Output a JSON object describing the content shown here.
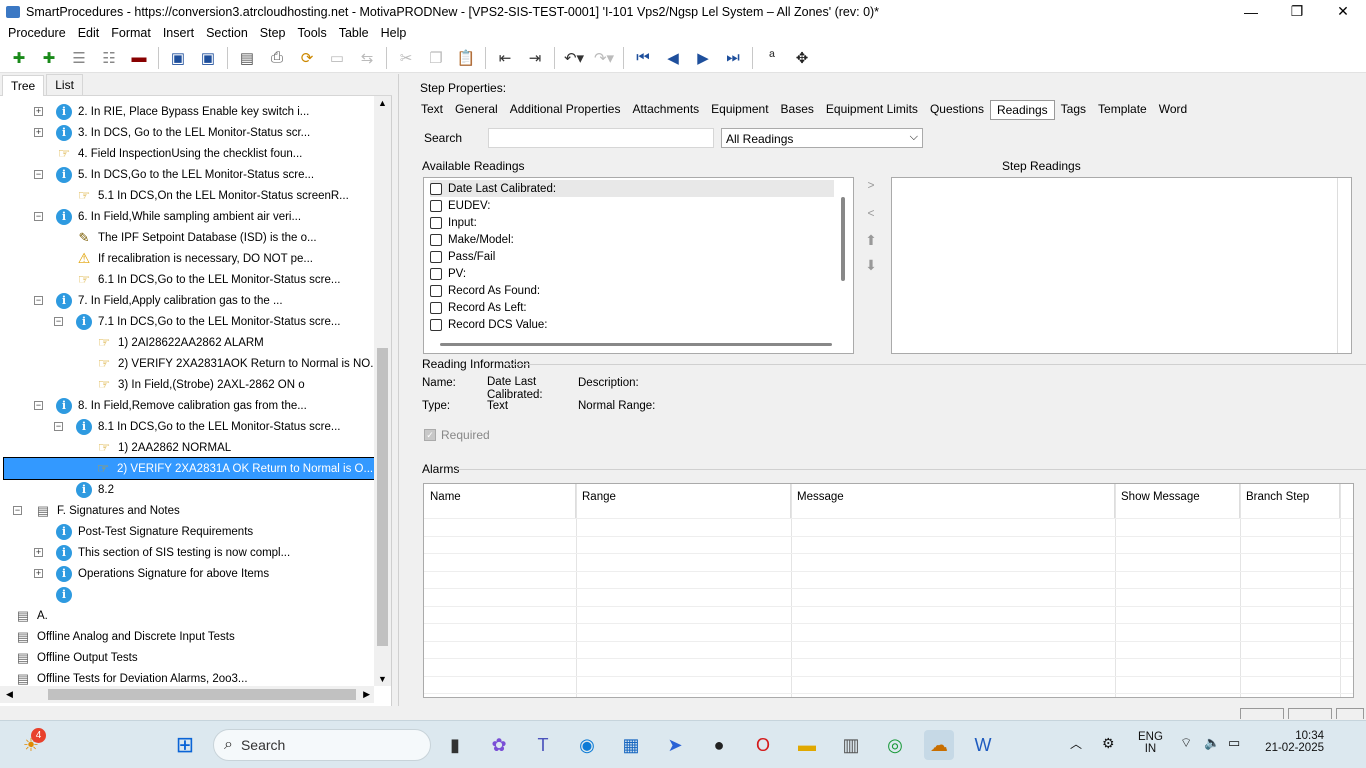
{
  "window": {
    "title": "SmartProcedures - https://conversion3.atrcloudhosting.net - MotivaPRODNew - [VPS2-SIS-TEST-0001] 'I-101 Vps2/Ngsp Lel System – All Zones' (rev: 0)*",
    "minimize": "—",
    "restore": "❐",
    "close": "✕"
  },
  "menu": [
    "Procedure",
    "Edit",
    "Format",
    "Insert",
    "Section",
    "Step",
    "Tools",
    "Table",
    "Help"
  ],
  "left_tabs": {
    "tree": "Tree",
    "list": "List"
  },
  "tree": [
    {
      "label": "2. In RIE, Place Bypass Enable key switch i...",
      "icon": "info-icon",
      "expander": "+"
    },
    {
      "label": "3. In DCS, Go to the LEL Monitor-Status scr...",
      "icon": "info-icon",
      "expander": "+"
    },
    {
      "label": "4. Field InspectionUsing the checklist foun...",
      "icon": "pointing-hand-icon",
      "expander": ""
    },
    {
      "label": "5. In DCS,Go to the LEL Monitor-Status scre...",
      "icon": "info-icon",
      "expander": "−"
    },
    {
      "label": "5.1 In DCS,On the LEL Monitor-Status screenR...",
      "icon": "pointing-hand-icon",
      "expander": ""
    },
    {
      "label": "6. In Field,While sampling ambient air veri...",
      "icon": "info-icon",
      "expander": "−"
    },
    {
      "label": "The IPF Setpoint Database (ISD) is the o...",
      "icon": "note-icon",
      "expander": ""
    },
    {
      "label": "If recalibration is necessary, DO NOT pe...",
      "icon": "warning-icon",
      "expander": ""
    },
    {
      "label": "6.1 In DCS,Go to the LEL Monitor-Status scre...",
      "icon": "pointing-hand-icon",
      "expander": ""
    },
    {
      "label": "7. In Field,Apply calibration gas to the ...",
      "icon": "info-icon",
      "expander": "−"
    },
    {
      "label": "7.1 In DCS,Go to the LEL Monitor-Status scre...",
      "icon": "info-icon",
      "expander": "−"
    },
    {
      "label": "1) 2AI28622AA2862 ALARM",
      "icon": "pointing-hand-icon",
      "expander": ""
    },
    {
      "label": "2) VERIFY 2XA2831AOK Return to Normal is NO...",
      "icon": "pointing-hand-icon",
      "expander": ""
    },
    {
      "label": "3) In Field,(Strobe) 2AXL-2862 ON o",
      "icon": "pointing-hand-icon",
      "expander": ""
    },
    {
      "label": "8. In Field,Remove calibration gas from the...",
      "icon": "info-icon",
      "expander": "−"
    },
    {
      "label": "8.1 In DCS,Go to the LEL Monitor-Status scre...",
      "icon": "info-icon",
      "expander": "−"
    },
    {
      "label": "1) 2AA2862 NORMAL",
      "icon": "pointing-hand-icon",
      "expander": ""
    },
    {
      "label": "2) VERIFY 2XA2831A OK Return to Normal is O...",
      "icon": "pointing-hand-icon",
      "expander": "",
      "selected": true
    },
    {
      "label": "8.2",
      "icon": "info-icon",
      "expander": ""
    },
    {
      "label": "F. Signatures and Notes",
      "icon": "section-icon",
      "expander": "−"
    },
    {
      "label": "Post-Test Signature Requirements",
      "icon": "info-icon",
      "expander": ""
    },
    {
      "label": "This section of SIS testing is now compl...",
      "icon": "info-icon",
      "expander": "+"
    },
    {
      "label": "Operations Signature for above Items",
      "icon": "info-icon",
      "expander": "+"
    },
    {
      "label": "",
      "icon": "info-icon",
      "expander": ""
    },
    {
      "label": "A.",
      "icon": "section-icon",
      "expander": ""
    },
    {
      "label": "Offline Analog and Discrete Input Tests",
      "icon": "section-icon",
      "expander": ""
    },
    {
      "label": "Offline Output Tests",
      "icon": "section-icon",
      "expander": ""
    },
    {
      "label": "Offline Tests for Deviation Alarms, 2oo3...",
      "icon": "section-icon",
      "expander": ""
    }
  ],
  "step_properties": {
    "label": "Step Properties:",
    "tabs": [
      "Text",
      "General",
      "Additional Properties",
      "Attachments",
      "Equipment",
      "Bases",
      "Equipment Limits",
      "Questions",
      "Readings",
      "Tags",
      "Template",
      "Word"
    ],
    "active_tab": "Readings",
    "search_label": "Search",
    "search_value": "",
    "filter_value": "All Readings",
    "available_label": "Available Readings",
    "step_readings_label": "Step Readings",
    "available_readings": [
      "Date Last Calibrated:",
      "EUDEV:",
      "Input:",
      "Make/Model:",
      "Pass/Fail",
      "PV:",
      "Record As Found:",
      "Record As Left:",
      "Record DCS Value:"
    ],
    "reading_info": {
      "label": "Reading Information",
      "name_label": "Name:",
      "name_value_line1": "Date Last",
      "name_value_line2": "Calibrated:",
      "type_label": "Type:",
      "type_value": "Text",
      "description_label": "Description:",
      "normal_range_label": "Normal Range:",
      "required_label": "Required",
      "required_checked": true
    },
    "alarms": {
      "label": "Alarms",
      "columns": [
        "Name",
        "Range",
        "Message",
        "Show Message",
        "Branch Step"
      ]
    }
  },
  "taskbar": {
    "search_placeholder": "Search",
    "notification_badge": "4",
    "lang_line1": "ENG",
    "lang_line2": "IN",
    "time": "10:34",
    "date": "21-02-2025"
  },
  "colors": {
    "selection": "#3399ff",
    "info_icon": "#2e9ae0",
    "taskbar": "#dce8ef"
  }
}
